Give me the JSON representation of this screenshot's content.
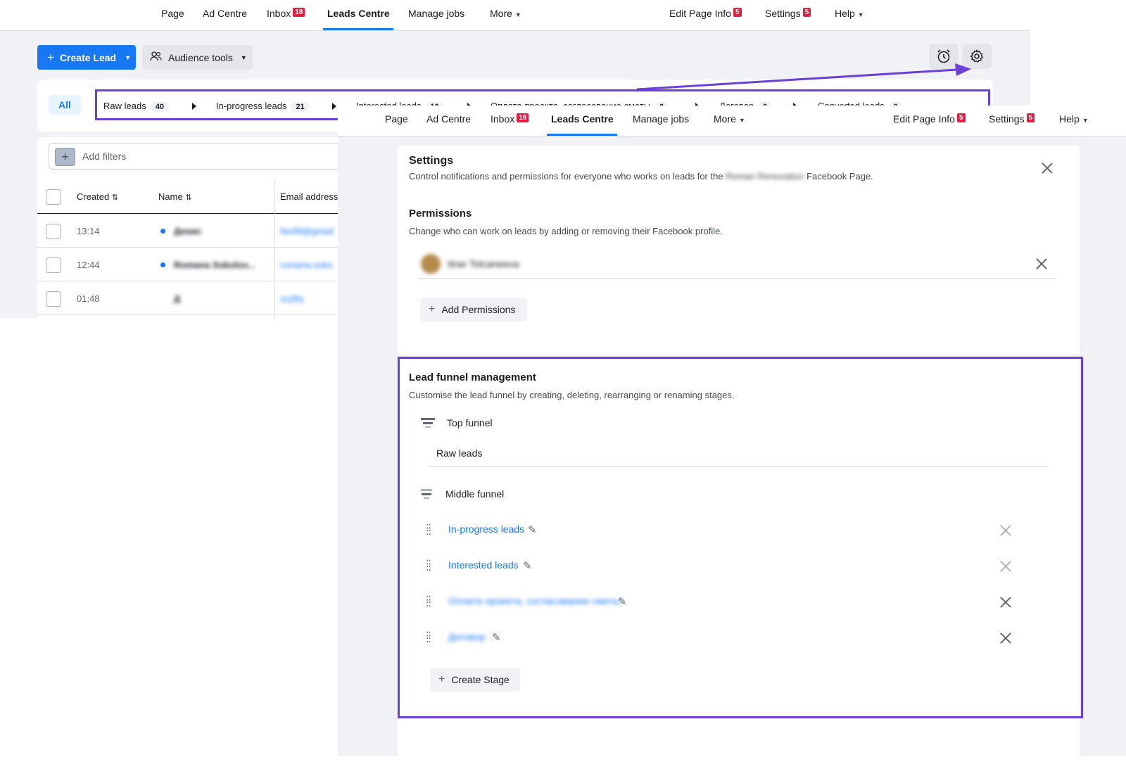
{
  "nav": {
    "page": "Page",
    "ad_centre": "Ad Centre",
    "inbox": "Inbox",
    "inbox_badge": "18",
    "leads_centre": "Leads Centre",
    "manage_jobs": "Manage jobs",
    "more": "More",
    "edit_page_info": "Edit Page Info",
    "edit_page_info_badge": "5",
    "settings": "Settings",
    "settings_badge": "5",
    "help": "Help"
  },
  "toolbar": {
    "create_lead": "Create Lead",
    "audience_tools": "Audience tools"
  },
  "stages": {
    "all_label": "All",
    "tabs": [
      {
        "label": "Raw leads",
        "count": "40"
      },
      {
        "label": "In-progress leads",
        "count": "21"
      },
      {
        "label": "Interested leads",
        "count": "10"
      },
      {
        "label": "Оплата проекта, согласование сметы",
        "count": "0"
      },
      {
        "label": "Договор",
        "count": "0"
      },
      {
        "label": "Converted leads",
        "count": "0"
      }
    ]
  },
  "filters": {
    "add_filters": "Add filters"
  },
  "table": {
    "headers": {
      "created": "Created",
      "name": "Name",
      "email": "Email address"
    },
    "rows": [
      {
        "created": "13:14",
        "name": "Денис",
        "email": "fav99@gmail"
      },
      {
        "created": "12:44",
        "name": "Romana Sokolov...",
        "email": "romana.soko"
      },
      {
        "created": "01:48",
        "name": "Д",
        "email": "ocj9ty"
      }
    ]
  },
  "settings_panel": {
    "title": "Settings",
    "subtitle_pre": "Control notifications and permissions for everyone who works on leads for the",
    "subtitle_page": "Roman Renovation",
    "subtitle_post": "Facebook Page.",
    "permissions_title": "Permissions",
    "permissions_sub": "Change who can work on leads by adding or removing their Facebook profile.",
    "person_name": "Ilnar Tolcaneeva",
    "add_permissions": "Add Permissions"
  },
  "funnel": {
    "title": "Lead funnel management",
    "subtitle": "Customise the lead funnel by creating, deleting, rearranging or renaming stages.",
    "top_label": "Top funnel",
    "top_stage": "Raw leads",
    "middle_label": "Middle funnel",
    "middle_stages": [
      "In-progress leads",
      "Interested leads",
      "Оплата проекта, согласование сметы",
      "Договор"
    ],
    "create_stage": "Create Stage"
  },
  "colors": {
    "primary": "#1877f2",
    "highlight": "#6b3fd8",
    "badge": "#e41e3f"
  }
}
